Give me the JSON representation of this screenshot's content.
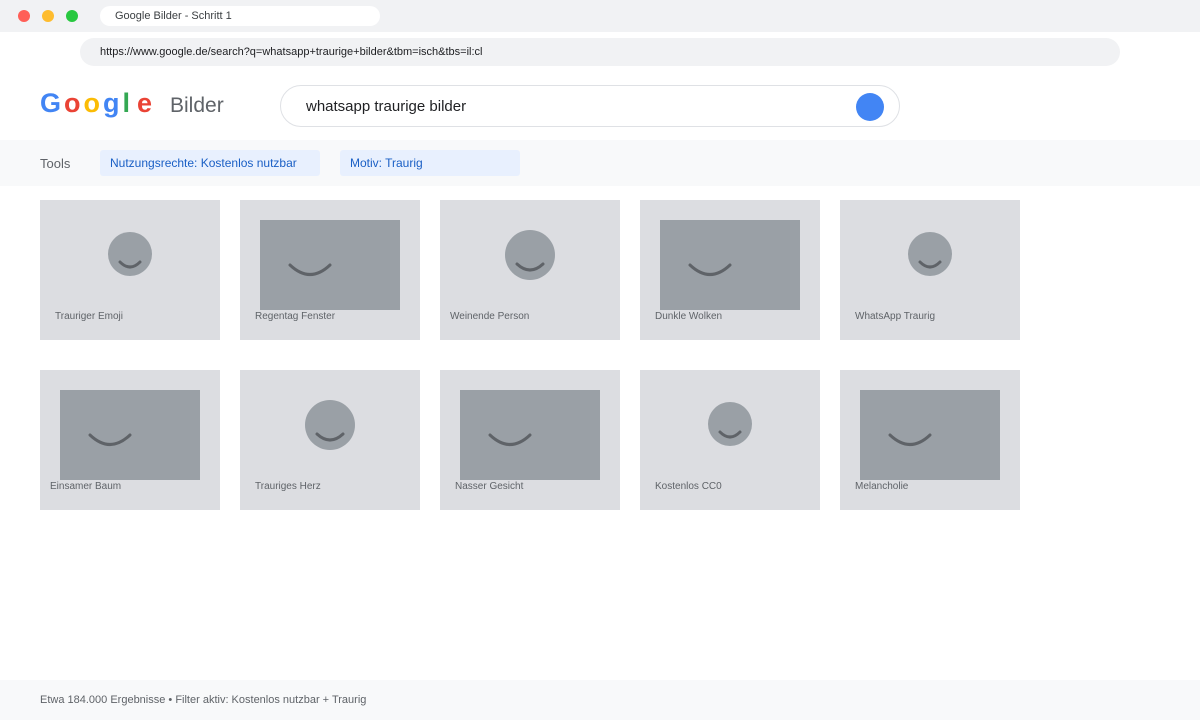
{
  "window": {
    "tab_title": "Google Bilder - Schritt 1",
    "url": "https://www.google.de/search?q=whatsapp+traurige+bilder&tbm=isch&tbs=il:cl"
  },
  "header": {
    "logo_letters": [
      "G",
      "o",
      "o",
      "g",
      "l",
      "e"
    ],
    "product": "Bilder",
    "search_query": "whatsapp traurige bilder"
  },
  "colors": {
    "google_blue": "#4285f4",
    "google_red": "#ea4335",
    "google_yellow": "#fbbc05",
    "google_green": "#34a853",
    "chip_bg": "#e8f0fe",
    "chip_text": "#1a5fc5"
  },
  "tools": {
    "label": "Tools",
    "filters": [
      "Nutzungsrechte: Kostenlos nutzbar",
      "Motiv: Traurig"
    ]
  },
  "results": [
    {
      "caption": "Trauriger Emoji",
      "shape": "circle"
    },
    {
      "caption": "Regentag Fenster",
      "shape": "rect"
    },
    {
      "caption": "Weinende Person",
      "shape": "circle"
    },
    {
      "caption": "Dunkle Wolken",
      "shape": "rect"
    },
    {
      "caption": "WhatsApp Traurig",
      "shape": "circle"
    },
    {
      "caption": "Einsamer Baum",
      "shape": "rect"
    },
    {
      "caption": "Trauriges Herz",
      "shape": "circle"
    },
    {
      "caption": "Nasser Gesicht",
      "shape": "rect"
    },
    {
      "caption": "Kostenlos CC0",
      "shape": "circle"
    },
    {
      "caption": "Melancholie",
      "shape": "rect"
    }
  ],
  "footer": {
    "stats": "Etwa 184.000 Ergebnisse • Filter aktiv: Kostenlos nutzbar + Traurig"
  }
}
